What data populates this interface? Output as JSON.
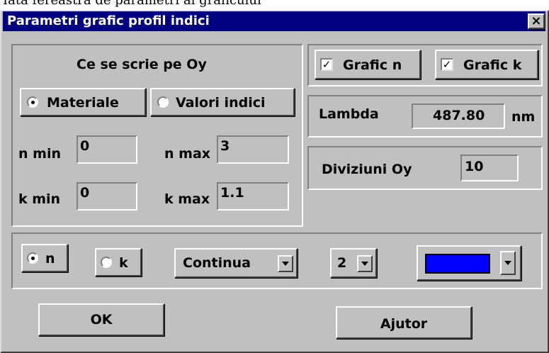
{
  "top_caption": "Iată fereastra de parametri ai graficului",
  "dialog": {
    "title": "Parametri grafic profil indici",
    "close_symbol": "×"
  },
  "oy_group": {
    "heading": "Ce se scrie pe Oy",
    "option_materiale": "Materiale",
    "option_valori": "Valori indici",
    "selected": "Materiale",
    "n_min_label": "n min",
    "n_min_value": "0",
    "n_max_label": "n max",
    "n_max_value": "3",
    "k_min_label": "k min",
    "k_min_value": "0",
    "k_max_label": "k max",
    "k_max_value": "1.1"
  },
  "graph_checks": {
    "grafic_n_label": "Grafic n",
    "grafic_n_checked": true,
    "grafic_k_label": "Grafic k",
    "grafic_k_checked": true,
    "check_mark": "✓"
  },
  "lambda": {
    "label": "Lambda",
    "value": "487.80",
    "unit": "nm"
  },
  "diviziuni": {
    "label": "Diviziuni Oy",
    "value": "10"
  },
  "style_row": {
    "radio_n": "n",
    "radio_k": "k",
    "selected": "n",
    "line_style": "Continua",
    "line_width": "2",
    "color": "#0000ff"
  },
  "buttons": {
    "ok": "OK",
    "help": "Ajutor"
  }
}
